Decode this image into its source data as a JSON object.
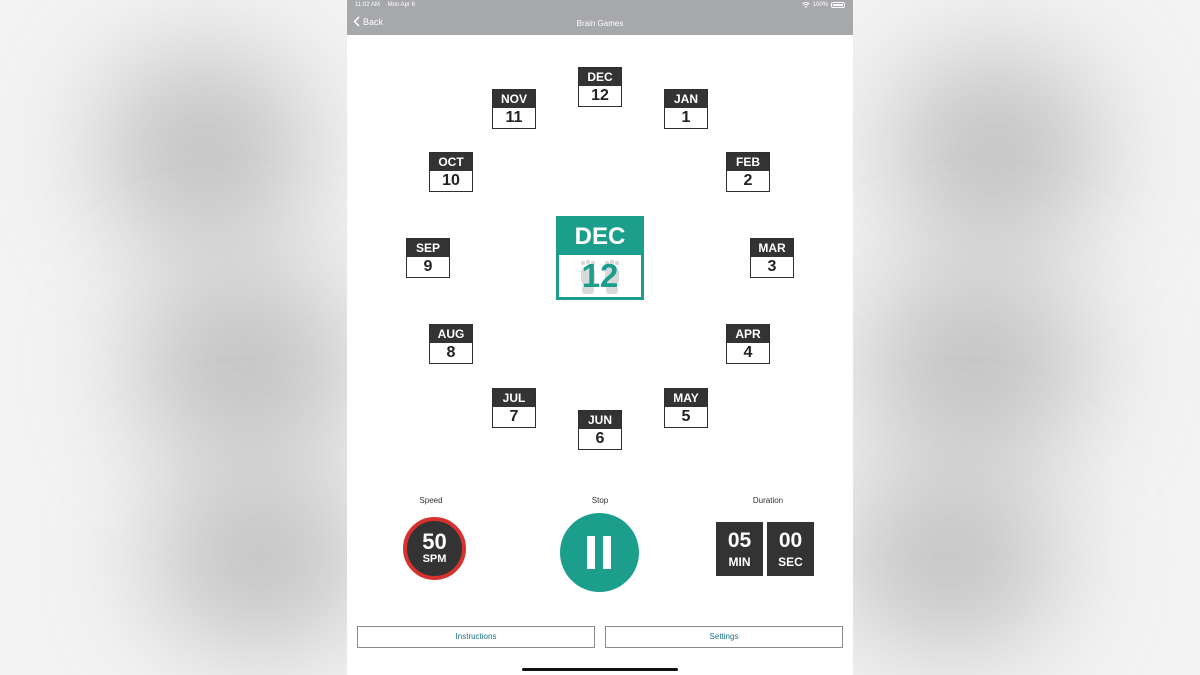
{
  "status_bar": {
    "time": "11:02 AM",
    "date": "Mon Apr 6",
    "battery": "100%"
  },
  "nav": {
    "back_label": "Back",
    "title": "Brain Games"
  },
  "months": [
    {
      "name": "DEC",
      "num": "12"
    },
    {
      "name": "JAN",
      "num": "1"
    },
    {
      "name": "FEB",
      "num": "2"
    },
    {
      "name": "MAR",
      "num": "3"
    },
    {
      "name": "APR",
      "num": "4"
    },
    {
      "name": "MAY",
      "num": "5"
    },
    {
      "name": "JUN",
      "num": "6"
    },
    {
      "name": "JUL",
      "num": "7"
    },
    {
      "name": "AUG",
      "num": "8"
    },
    {
      "name": "SEP",
      "num": "9"
    },
    {
      "name": "OCT",
      "num": "10"
    },
    {
      "name": "NOV",
      "num": "11"
    }
  ],
  "current": {
    "month": "DEC",
    "day": "12"
  },
  "controls": {
    "speed_label": "Speed",
    "speed_value": "50",
    "speed_unit": "SPM",
    "stop_label": "Stop",
    "duration_label": "Duration",
    "duration_min": "05",
    "duration_min_unit": "MIN",
    "duration_sec": "00",
    "duration_sec_unit": "SEC"
  },
  "buttons": {
    "instructions": "Instructions",
    "settings": "Settings"
  },
  "colors": {
    "accent": "#1b9f8c",
    "dark": "#333333",
    "speed_ring": "#d8322f",
    "nav_bar": "#a7a8ab",
    "link": "#1a6e8a"
  },
  "icons": {
    "back": "chevron-left-icon",
    "pause": "pause-icon",
    "wifi": "wifi-icon",
    "battery": "battery-icon",
    "footprints": "footprints-icon"
  }
}
